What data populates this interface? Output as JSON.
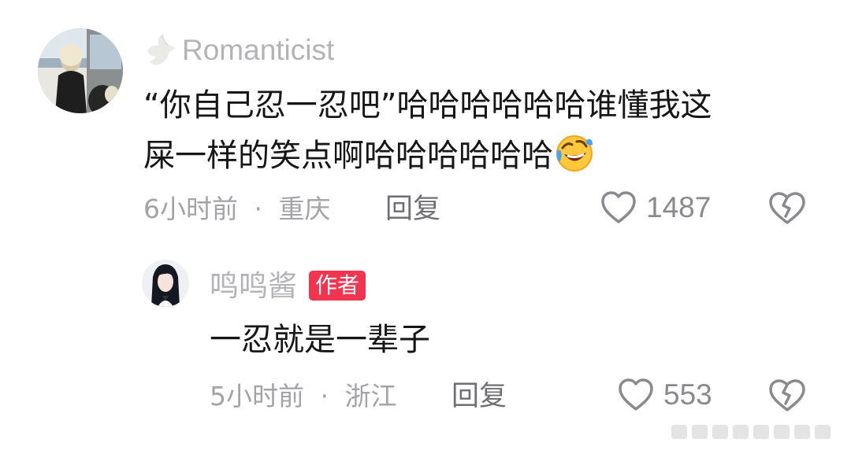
{
  "comment": {
    "username": "Romanticist",
    "badge_icon": "dove-icon",
    "text_line1": "“你自己忍一忍吧”哈哈哈哈哈哈谁懂我这",
    "text_line2": "屎一样的笑点啊哈哈哈哈哈哈",
    "emoji": "rolling-on-floor-laughing-emoji",
    "time": "6小时前",
    "separator": "·",
    "location": "重庆",
    "reply_label": "回复",
    "like_count": "1487"
  },
  "reply": {
    "username": "鸣鸣酱",
    "author_badge": "作者",
    "text": "一忍就是一辈子",
    "time": "5小时前",
    "separator": "·",
    "location": "浙江",
    "reply_label": "回复",
    "like_count": "553"
  },
  "colors": {
    "author_badge": "#f2354f",
    "text": "#161616",
    "meta": "#a3a3a8"
  }
}
